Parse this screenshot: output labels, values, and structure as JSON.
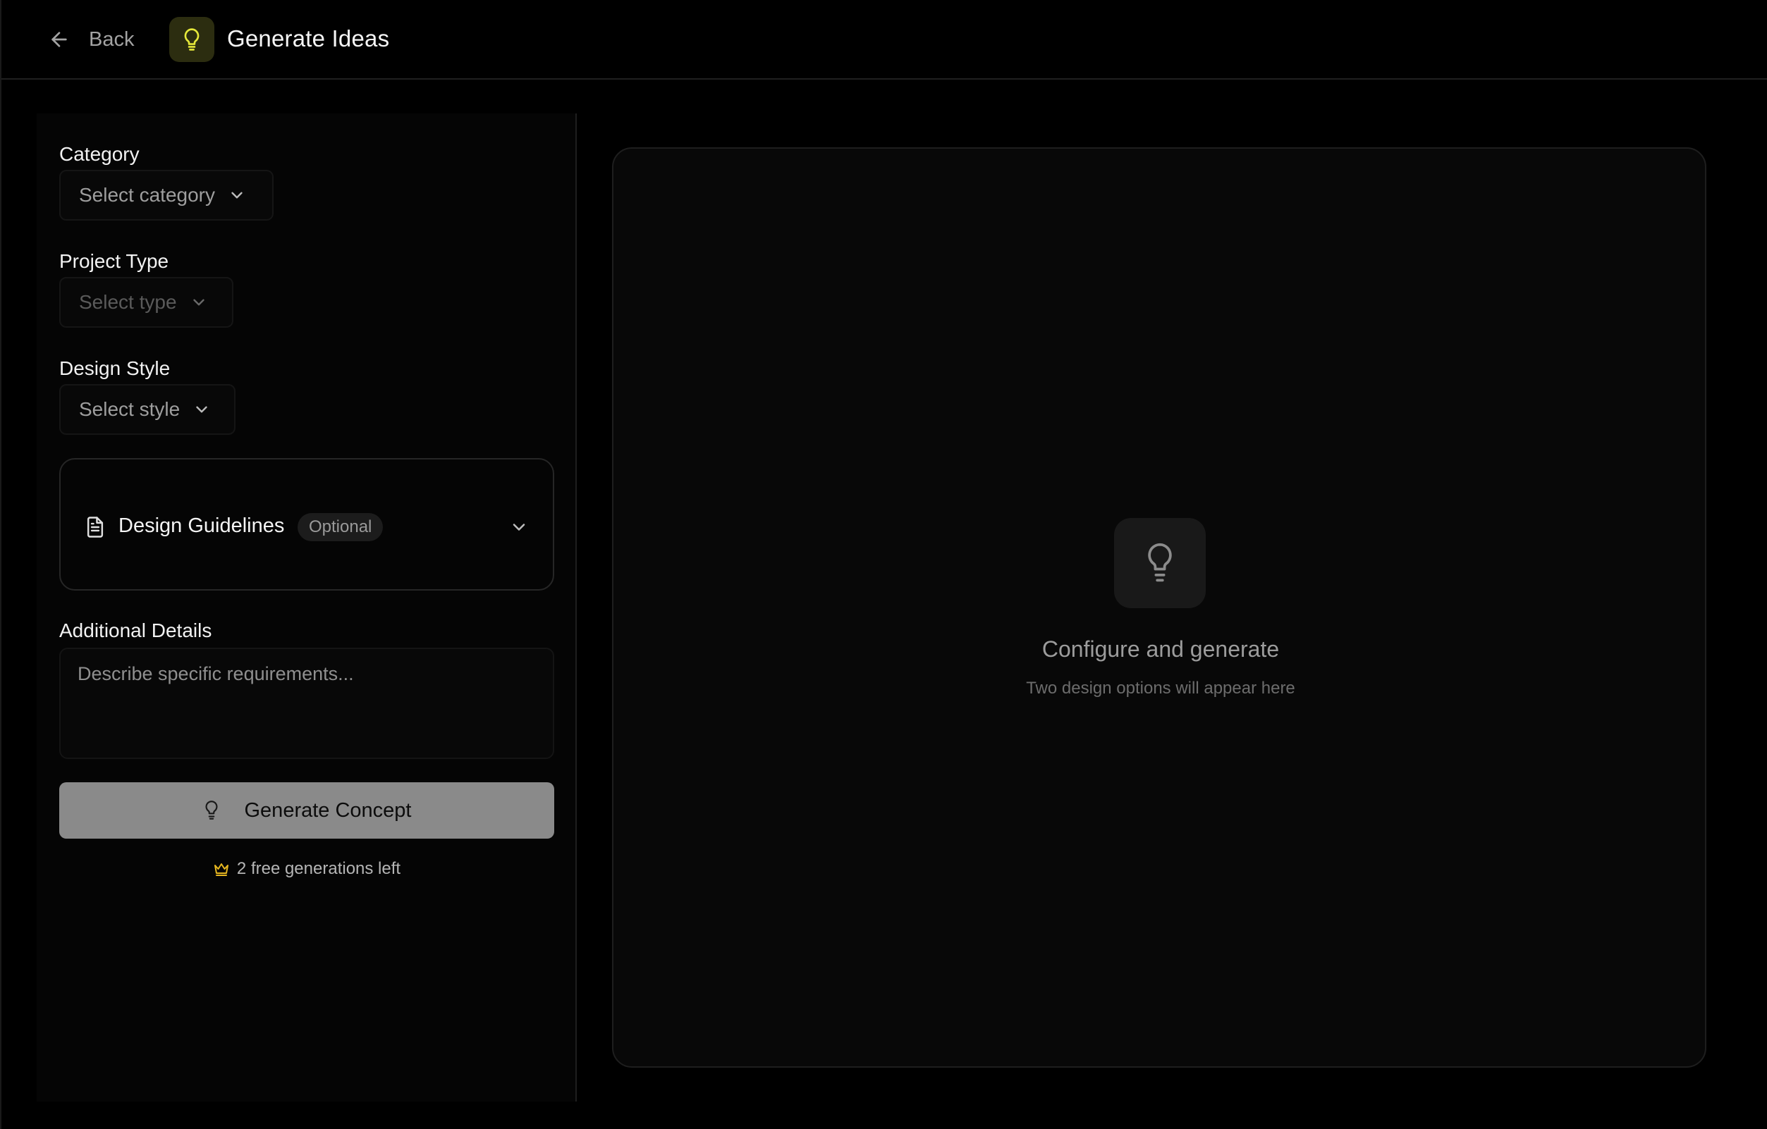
{
  "header": {
    "back_label": "Back",
    "title": "Generate Ideas"
  },
  "form": {
    "category": {
      "label": "Category",
      "value": "Select category"
    },
    "project_type": {
      "label": "Project Type",
      "value": "Select type",
      "disabled": true
    },
    "design_style": {
      "label": "Design Style",
      "value": "Select style"
    },
    "guidelines": {
      "title": "Design Guidelines",
      "badge": "Optional"
    },
    "details": {
      "label": "Additional Details",
      "placeholder": "Describe specific requirements..."
    },
    "generate_label": "Generate Concept",
    "free_note": "2 free generations left"
  },
  "preview": {
    "title": "Configure and generate",
    "subtitle": "Two design options will appear here"
  },
  "colors": {
    "accent": "#e5e83a",
    "crown": "#e8b820",
    "background": "#000000",
    "button": "#8a8a8a"
  },
  "icons": {
    "back": "arrow-left-icon",
    "app": "lightbulb-icon",
    "dropdown": "chevron-down-icon",
    "guidelines": "document-icon",
    "crown": "crown-icon"
  }
}
